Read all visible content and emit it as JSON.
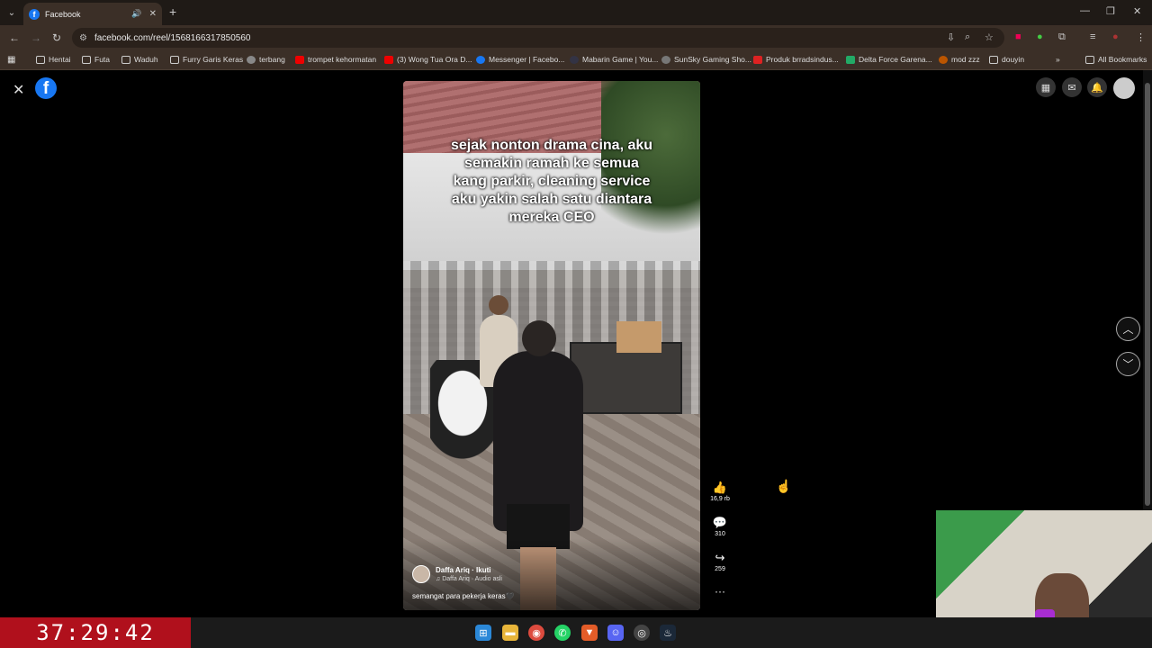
{
  "browser": {
    "tab_title": "Facebook",
    "tab_favicon": "f",
    "url": "facebook.com/reel/1568166317850560",
    "bookmarks": [
      {
        "label": "Hentai",
        "icon": "folder-icon"
      },
      {
        "label": "Futa",
        "icon": "folder-icon"
      },
      {
        "label": "Waduh",
        "icon": "folder-icon"
      },
      {
        "label": "Furry Garis Keras",
        "icon": "folder-icon"
      },
      {
        "label": "terbang",
        "icon": "site-icon"
      },
      {
        "label": "trompet kehormatan",
        "icon": "youtube-icon"
      },
      {
        "label": "(3) Wong Tua Ora D...",
        "icon": "youtube-icon"
      },
      {
        "label": "Messenger | Facebo...",
        "icon": "facebook-icon"
      },
      {
        "label": "Mabarin Game | You...",
        "icon": "site-icon"
      },
      {
        "label": "SunSky Gaming Sho...",
        "icon": "site-icon"
      },
      {
        "label": "Produk brradsindus...",
        "icon": "shop-icon"
      },
      {
        "label": "Delta Force Garena...",
        "icon": "game-icon"
      },
      {
        "label": "mod zzz",
        "icon": "site-icon"
      },
      {
        "label": "douyin",
        "icon": "folder-icon"
      }
    ],
    "all_bookmarks": "All Bookmarks",
    "overflow": "»"
  },
  "reel": {
    "caption": "sejak nonton drama cina, aku\nsemakin ramah ke semua\nkang parkir, cleaning service\naku yakin salah satu diantara\nmereka CEO",
    "author": "Daffa Ariq",
    "follow": "· Ikuti",
    "audio": "♫ Daffa Ariq · Audio asli",
    "description": "semangat para pekerja keras🖤",
    "likes": "16,9 rb",
    "comments": "310",
    "shares": "259",
    "more": "···"
  },
  "stream": {
    "timer": "37:29:42"
  },
  "colors": {
    "facebook_blue": "#1877f2",
    "timer_red": "#b0101c"
  }
}
